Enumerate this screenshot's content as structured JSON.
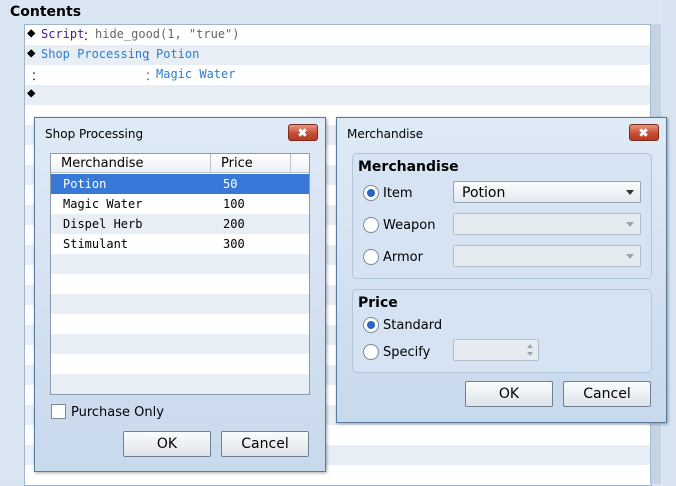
{
  "contents": {
    "title": "Contents",
    "lines": [
      {
        "marker": "◆",
        "command": "Script",
        "sep": "：",
        "args": "hide_good(1, \"true\")"
      },
      {
        "marker": "◆",
        "command": "Shop Processing",
        "sep": "：",
        "args": "Potion"
      },
      {
        "marker": "：",
        "command": "",
        "sep": "：",
        "args": "Magic Water"
      },
      {
        "marker": "◆",
        "command": "",
        "sep": "",
        "args": ""
      }
    ]
  },
  "shop_dialog": {
    "title": "Shop Processing",
    "columns": [
      "Merchandise",
      "Price"
    ],
    "rows": [
      {
        "item": "Potion",
        "price": "50"
      },
      {
        "item": "Magic Water",
        "price": "100"
      },
      {
        "item": "Dispel Herb",
        "price": "200"
      },
      {
        "item": "Stimulant",
        "price": "300"
      }
    ],
    "selected_row": 0,
    "purchase_only_label": "Purchase Only",
    "purchase_only_checked": false,
    "ok_label": "OK",
    "cancel_label": "Cancel"
  },
  "merch_dialog": {
    "title": "Merchandise",
    "merch_group_title": "Merchandise",
    "item_label": "Item",
    "item_value": "Potion",
    "weapon_label": "Weapon",
    "weapon_value": "",
    "armor_label": "Armor",
    "armor_value": "",
    "selected_type": "item",
    "price_group_title": "Price",
    "standard_label": "Standard",
    "specify_label": "Specify",
    "specify_value": "",
    "price_mode": "standard",
    "ok_label": "OK",
    "cancel_label": "Cancel"
  },
  "colors": {
    "script_command": "#4b1a8a",
    "shop_command": "#2a7ed0",
    "args_gray": "#666666",
    "args_blue": "#2a7ed0",
    "selection": "#3878d8"
  }
}
